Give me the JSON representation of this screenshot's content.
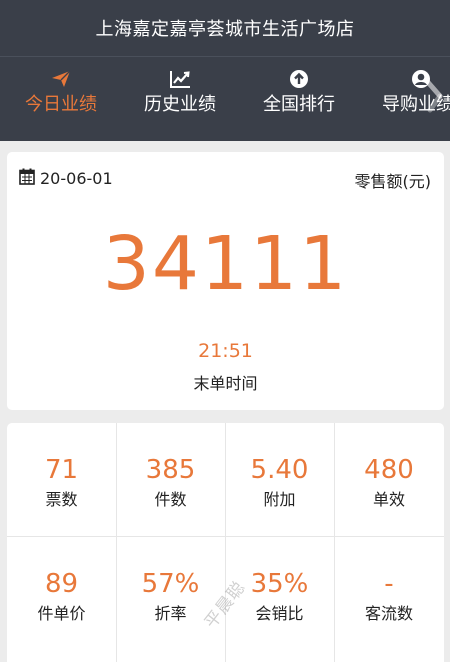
{
  "header": {
    "store_name": "上海嘉定嘉亭荟城市生活广场店",
    "tabs": [
      {
        "label": "今日业绩",
        "icon": "paper-plane-icon",
        "active": true
      },
      {
        "label": "历史业绩",
        "icon": "line-chart-icon",
        "active": false
      },
      {
        "label": "全国排行",
        "icon": "arrow-up-circle-icon",
        "active": false
      },
      {
        "label": "导购业绩",
        "icon": "user-circle-icon",
        "active": false
      }
    ]
  },
  "summary": {
    "date": "20-06-01",
    "unit_label": "零售额(元)",
    "retail_amount": "34111",
    "last_order_time": "21:51",
    "last_order_label": "末单时间"
  },
  "stats": [
    {
      "value": "71",
      "label": "票数"
    },
    {
      "value": "385",
      "label": "件数"
    },
    {
      "value": "5.40",
      "label": "附加"
    },
    {
      "value": "480",
      "label": "单效"
    },
    {
      "value": "89",
      "label": "件单价"
    },
    {
      "value": "57%",
      "label": "折率"
    },
    {
      "value": "35%",
      "label": "会销比"
    },
    {
      "value": "-",
      "label": "客流数"
    }
  ],
  "colors": {
    "header_bg": "#3a3f49",
    "accent": "#e8783a",
    "page_bg": "#ececec"
  },
  "watermark": "平晨聪"
}
